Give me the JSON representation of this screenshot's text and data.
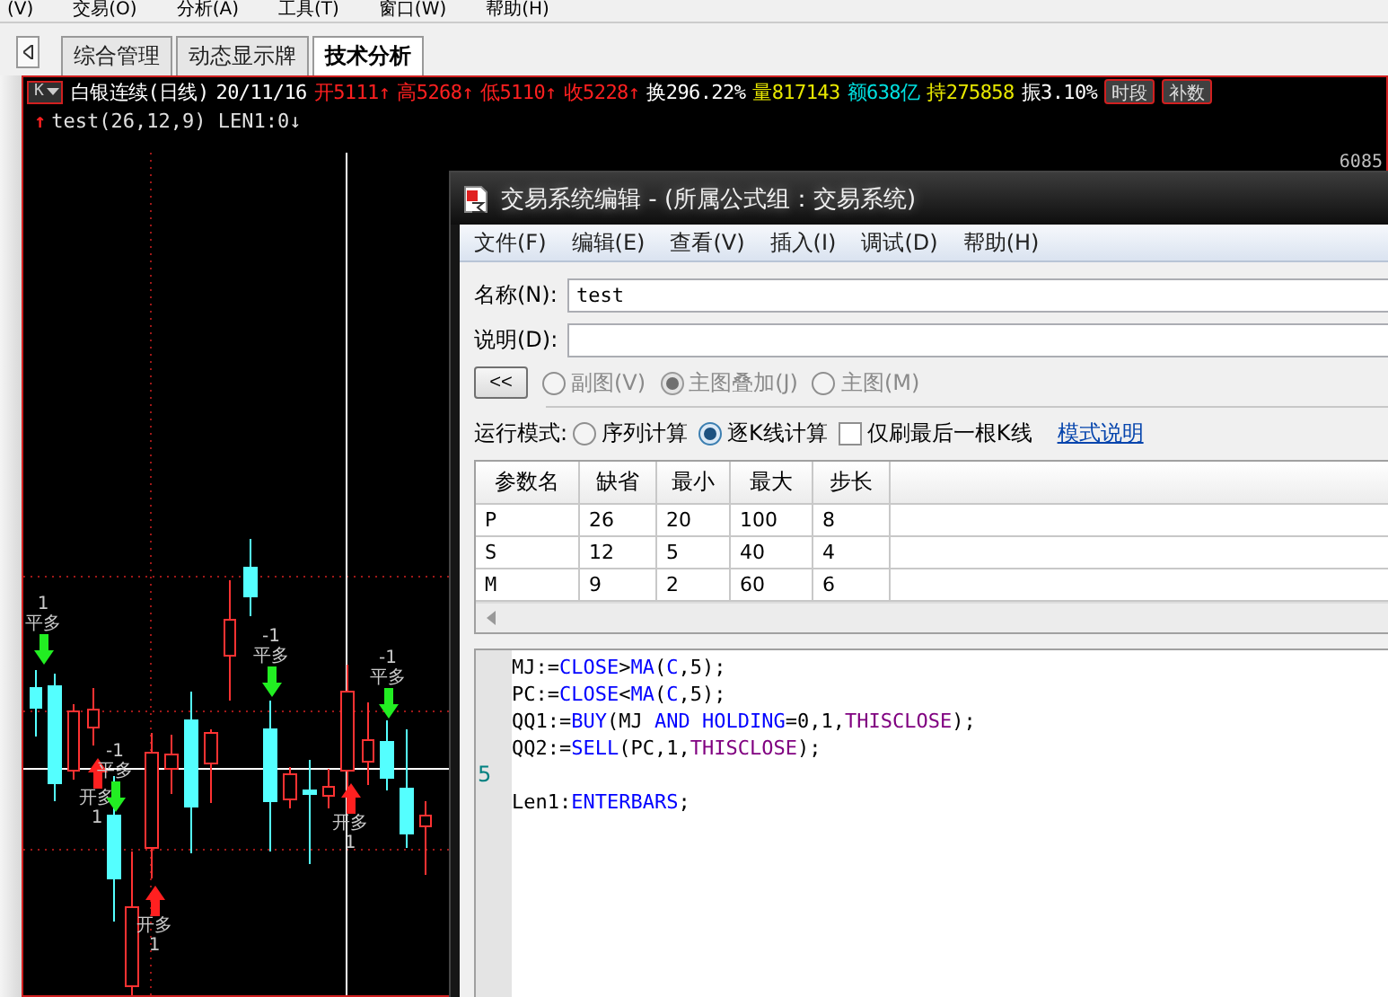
{
  "menu": [
    "(V)",
    "交易(O)",
    "分析(A)",
    "工具(T)",
    "窗口(W)",
    "帮助(H)"
  ],
  "tabs": [
    {
      "label": "综合管理",
      "selected": false
    },
    {
      "label": "动态显示牌",
      "selected": false
    },
    {
      "label": "技术分析",
      "selected": true
    }
  ],
  "chart": {
    "period_selector": "K",
    "quote": [
      {
        "text": "白银连续(日线)",
        "color": "#ffffff"
      },
      {
        "text": "20/11/16",
        "color": "#ffffff"
      },
      {
        "text": "开5111↑",
        "color": "#ff2020"
      },
      {
        "text": "高5268↑",
        "color": "#ff2020"
      },
      {
        "text": "低5110↑",
        "color": "#ff2020"
      },
      {
        "text": "收5228↑",
        "color": "#ff2020"
      },
      {
        "text": "换296.22%",
        "color": "#ffffff"
      },
      {
        "text": "量817143",
        "color": "#e8e800"
      },
      {
        "text": "额638亿",
        "color": "#00e0e0"
      },
      {
        "text": "持275858",
        "color": "#e8e800"
      },
      {
        "text": "振3.10%",
        "color": "#ffffff"
      }
    ],
    "buttons": [
      "时段",
      "补数"
    ],
    "indicator": {
      "marker": "↑",
      "text": "test(26,12,9) LEN1:0↓"
    },
    "price_label": "6085",
    "signals": [
      {
        "kind": "close",
        "value": "1",
        "label": "平多"
      },
      {
        "kind": "open",
        "value": "1",
        "label": "开多"
      },
      {
        "kind": "close",
        "value": "-1",
        "label": "平多"
      },
      {
        "kind": "open",
        "value": "1",
        "label": "开多"
      },
      {
        "kind": "close",
        "value": "-1",
        "label": "平多"
      },
      {
        "kind": "open",
        "value": "1",
        "label": "开多"
      },
      {
        "kind": "close",
        "value": "-1",
        "label": "平多"
      }
    ]
  },
  "dialog": {
    "title": "交易系统编辑 - (所属公式组：交易系统)",
    "menu": [
      "文件(F)",
      "编辑(E)",
      "查看(V)",
      "插入(I)",
      "调试(D)",
      "帮助(H)"
    ],
    "name": {
      "label": "名称(N):",
      "value": "test"
    },
    "description": {
      "label": "说明(D):"
    },
    "collapse_button": "<<",
    "chart_types": [
      {
        "label": "副图(V)",
        "selected": false,
        "disabled": true
      },
      {
        "label": "主图叠加(J)",
        "selected": true,
        "disabled": true
      },
      {
        "label": "主图(M)",
        "selected": false,
        "disabled": true
      }
    ],
    "run_mode": {
      "label": "运行模式:",
      "options": [
        {
          "label": "序列计算",
          "selected": false
        },
        {
          "label": "逐K线计算",
          "selected": true
        }
      ],
      "refresh_last_only": {
        "label": "仅刷最后一根K线",
        "checked": false
      },
      "help_link": "模式说明"
    },
    "params": {
      "columns": [
        "参数名",
        "缺省",
        "最小",
        "最大",
        "步长"
      ],
      "rows": [
        [
          "P",
          "26",
          "20",
          "100",
          "8"
        ],
        [
          "S",
          "12",
          "5",
          "40",
          "4"
        ],
        [
          "M",
          "9",
          "2",
          "60",
          "6"
        ]
      ]
    },
    "code": [
      {
        "tokens": [
          {
            "text": "MJ:=",
            "kind": "plain"
          },
          {
            "text": "CLOSE",
            "kind": "keyword"
          },
          {
            "text": ">",
            "kind": "plain"
          },
          {
            "text": "MA",
            "kind": "keyword"
          },
          {
            "text": "(",
            "kind": "plain"
          },
          {
            "text": "C",
            "kind": "keyword"
          },
          {
            "text": ",5);",
            "kind": "plain"
          }
        ]
      },
      {
        "tokens": [
          {
            "text": "PC:=",
            "kind": "plain"
          },
          {
            "text": "CLOSE",
            "kind": "keyword"
          },
          {
            "text": "<",
            "kind": "plain"
          },
          {
            "text": "MA",
            "kind": "keyword"
          },
          {
            "text": "(",
            "kind": "plain"
          },
          {
            "text": "C",
            "kind": "keyword"
          },
          {
            "text": ",5);",
            "kind": "plain"
          }
        ]
      },
      {
        "tokens": [
          {
            "text": "QQ1:=",
            "kind": "plain"
          },
          {
            "text": "BUY",
            "kind": "keyword"
          },
          {
            "text": "(MJ ",
            "kind": "plain"
          },
          {
            "text": "AND ",
            "kind": "keyword"
          },
          {
            "text": "HOLDING",
            "kind": "keyword"
          },
          {
            "text": "=0,1,",
            "kind": "plain"
          },
          {
            "text": "THISCLOSE",
            "kind": "constant"
          },
          {
            "text": ");",
            "kind": "plain"
          }
        ]
      },
      {
        "tokens": [
          {
            "text": "QQ2:=",
            "kind": "plain"
          },
          {
            "text": "SELL",
            "kind": "keyword"
          },
          {
            "text": "(PC,1,",
            "kind": "plain"
          },
          {
            "text": "THISCLOSE",
            "kind": "constant"
          },
          {
            "text": ");",
            "kind": "plain"
          }
        ]
      },
      {
        "line_number": "5"
      },
      {
        "tokens": [
          {
            "text": "Len1:",
            "kind": "plain"
          },
          {
            "text": "ENTERBARS",
            "kind": "keyword"
          },
          {
            "text": ";",
            "kind": "plain"
          }
        ]
      }
    ]
  }
}
